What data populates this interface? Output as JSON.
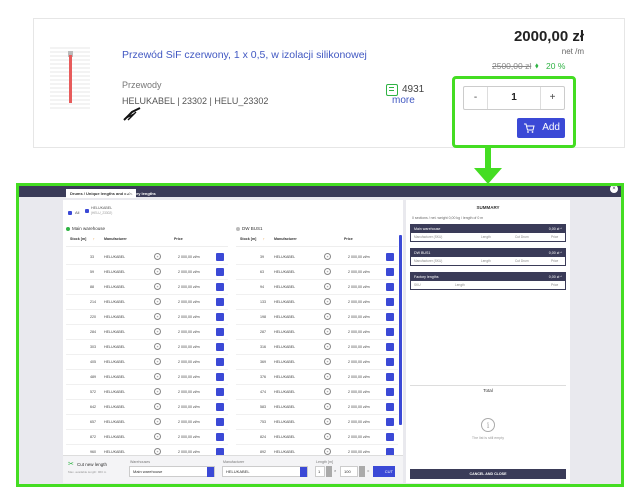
{
  "product": {
    "title": "Przewód SiF czerwony, 1 x 0,5, w izolacji silikonowej",
    "category": "Przewody",
    "meta": "HELUKABEL | 23302 | HELU_23302",
    "stock_count": "4931",
    "stock_more": "more",
    "price": "2000,00 zł",
    "unit": "net /m",
    "old_price": "2500,00 zł",
    "discount": "20 %",
    "quantity": "1",
    "minus": "-",
    "plus": "+",
    "add_label": "Add"
  },
  "modal": {
    "tabs": [
      "Drums / Unique lengths and cuts",
      "Factory lengths"
    ],
    "close": "×",
    "filter_all": "All",
    "filter_brand": "HELUKABEL",
    "filter_brand_code": "(HELU_23302)",
    "warehouses": [
      {
        "name": "Main warehouse",
        "head": {
          "stock": "Stock [m]",
          "manufacturer": "Manufacturer",
          "price": "Price"
        },
        "rows": [
          {
            "stock": "33",
            "manufacturer": "HELUKABEL",
            "price": "2 000,00 zł/m"
          },
          {
            "stock": "59",
            "manufacturer": "HELUKABEL",
            "price": "2 000,00 zł/m"
          },
          {
            "stock": "88",
            "manufacturer": "HELUKABEL",
            "price": "2 000,00 zł/m"
          },
          {
            "stock": "214",
            "manufacturer": "HELUKABEL",
            "price": "2 000,00 zł/m"
          },
          {
            "stock": "220",
            "manufacturer": "HELUKABEL",
            "price": "2 000,00 zł/m"
          },
          {
            "stock": "284",
            "manufacturer": "HELUKABEL",
            "price": "2 000,00 zł/m"
          },
          {
            "stock": "303",
            "manufacturer": "HELUKABEL",
            "price": "2 000,00 zł/m"
          },
          {
            "stock": "405",
            "manufacturer": "HELUKABEL",
            "price": "2 000,00 zł/m"
          },
          {
            "stock": "489",
            "manufacturer": "HELUKABEL",
            "price": "2 000,00 zł/m"
          },
          {
            "stock": "572",
            "manufacturer": "HELUKABEL",
            "price": "2 000,00 zł/m"
          },
          {
            "stock": "642",
            "manufacturer": "HELUKABEL",
            "price": "2 000,00 zł/m"
          },
          {
            "stock": "657",
            "manufacturer": "HELUKABEL",
            "price": "2 000,00 zł/m"
          },
          {
            "stock": "872",
            "manufacturer": "HELUKABEL",
            "price": "2 000,00 zł/m"
          },
          {
            "stock": "960",
            "manufacturer": "HELUKABEL",
            "price": "2 000,00 zł/m"
          }
        ]
      },
      {
        "name": "DW BUS1",
        "head": {
          "stock": "Stock [m]",
          "manufacturer": "Manufacturer",
          "price": "Price"
        },
        "rows": [
          {
            "stock": "39",
            "manufacturer": "HELUKABEL",
            "price": "2 000,00 zł/m"
          },
          {
            "stock": "63",
            "manufacturer": "HELUKABEL",
            "price": "2 000,00 zł/m"
          },
          {
            "stock": "94",
            "manufacturer": "HELUKABEL",
            "price": "2 000,00 zł/m"
          },
          {
            "stock": "133",
            "manufacturer": "HELUKABEL",
            "price": "2 000,00 zł/m"
          },
          {
            "stock": "198",
            "manufacturer": "HELUKABEL",
            "price": "2 000,00 zł/m"
          },
          {
            "stock": "287",
            "manufacturer": "HELUKABEL",
            "price": "2 000,00 zł/m"
          },
          {
            "stock": "316",
            "manufacturer": "HELUKABEL",
            "price": "2 000,00 zł/m"
          },
          {
            "stock": "369",
            "manufacturer": "HELUKABEL",
            "price": "2 000,00 zł/m"
          },
          {
            "stock": "376",
            "manufacturer": "HELUKABEL",
            "price": "2 000,00 zł/m"
          },
          {
            "stock": "474",
            "manufacturer": "HELUKABEL",
            "price": "2 000,00 zł/m"
          },
          {
            "stock": "583",
            "manufacturer": "HELUKABEL",
            "price": "2 000,00 zł/m"
          },
          {
            "stock": "753",
            "manufacturer": "HELUKABEL",
            "price": "2 000,00 zł/m"
          },
          {
            "stock": "824",
            "manufacturer": "HELUKABEL",
            "price": "2 000,00 zł/m"
          },
          {
            "stock": "892",
            "manufacturer": "HELUKABEL",
            "price": "2 000,00 zł/m"
          }
        ]
      }
    ],
    "summary": {
      "title": "SUMMARY",
      "subtitle": "0 sections / net. weight 0,00 kg / length of 0 m",
      "sections": [
        {
          "name": "Main warehouse",
          "value": "0,00 zł",
          "cols": [
            "Manufacturer (SKU)",
            "Length",
            "Cut Drum",
            "Price"
          ]
        },
        {
          "name": "DW BUS1",
          "value": "0,00 zł",
          "cols": [
            "Manufacturer (SKU)",
            "Length",
            "Cut Drum",
            "Price"
          ]
        },
        {
          "name": "Factory lengths",
          "value": "0,00 zł",
          "cols": [
            "SKU",
            "Length",
            "Price"
          ]
        }
      ],
      "total_label": "Total",
      "empty_text": "The list is still empty",
      "cancel_label": "CANCEL AND CLOSE"
    },
    "cut": {
      "title": "Cut new length",
      "hint": "Max. available length: 960 m",
      "warehouse_label": "Warehouses",
      "warehouse_value": "Main warehouse",
      "manufacturer_label": "Manufacturer",
      "manufacturer_value": "HELUKABEL",
      "length_label": "Length [m]",
      "qty": "1",
      "times": "×",
      "length_value": "100",
      "eq": "=",
      "cut_label": "CUT"
    }
  },
  "colors": {
    "accent": "#3b49d6",
    "highlight": "#44dd22",
    "dark": "#3a3b58",
    "success": "#2fb344"
  }
}
